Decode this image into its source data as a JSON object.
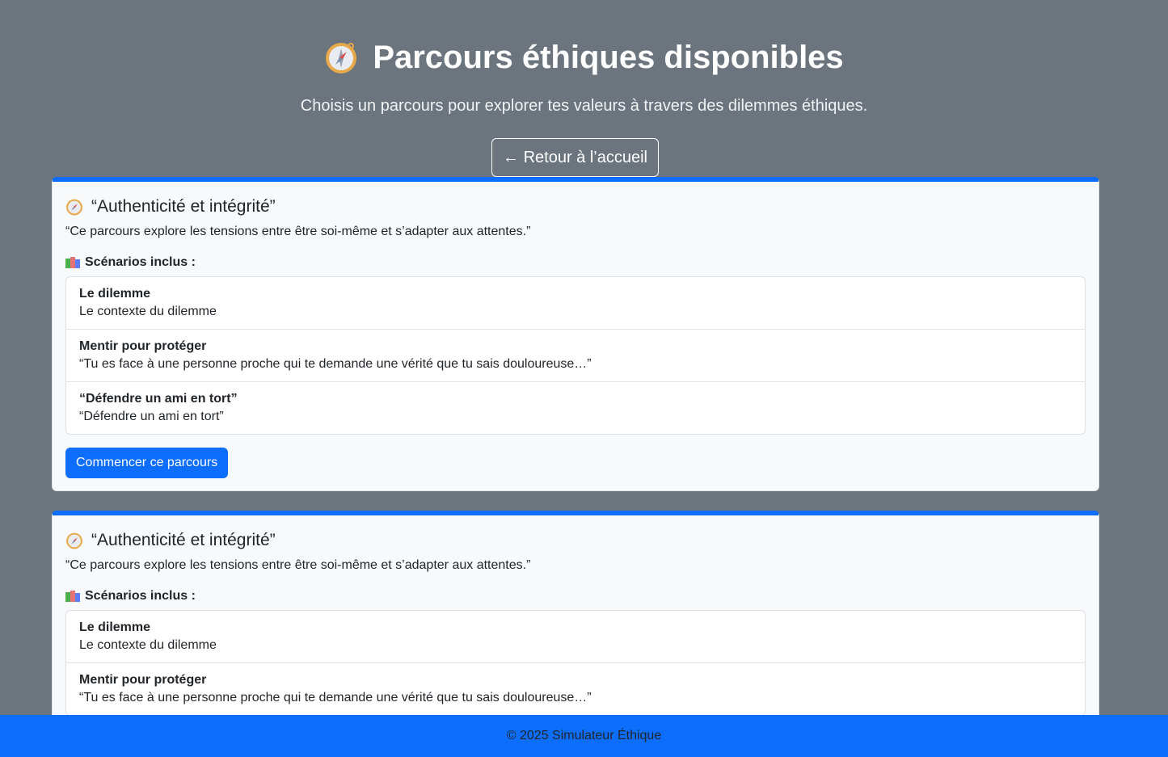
{
  "header": {
    "title": "Parcours éthiques disponibles",
    "subtitle": "Choisis un parcours pour explorer tes valeurs à travers des dilemmes éthiques.",
    "back_label": "← Retour à l’accueil",
    "icon": "compass-icon"
  },
  "parcours": [
    {
      "title": "“Authenticité et intégrité”",
      "description": "“Ce parcours explore les tensions entre être soi-même et s’adapter aux attentes.”",
      "scenarios_label": "Scénarios inclus :",
      "scenarios": [
        {
          "title": "Le dilemme",
          "text": "Le contexte du dilemme"
        },
        {
          "title": "Mentir pour protéger",
          "text": "“Tu es face à une personne proche qui te demande une vérité que tu sais douloureuse…”"
        },
        {
          "title": "“Défendre un ami en tort”",
          "text": "“Défendre un ami en tort”"
        }
      ],
      "start_label": "Commencer ce parcours"
    },
    {
      "title": "“Authenticité et intégrité”",
      "description": "“Ce parcours explore les tensions entre être soi-même et s’adapter aux attentes.”",
      "scenarios_label": "Scénarios inclus :",
      "scenarios": [
        {
          "title": "Le dilemme",
          "text": "Le contexte du dilemme"
        },
        {
          "title": "Mentir pour protéger",
          "text": "“Tu es face à une personne proche qui te demande une vérité que tu sais douloureuse…”"
        }
      ]
    }
  ],
  "footer": {
    "text": "© 2025 Simulateur Éthique"
  },
  "colors": {
    "background": "#6c757d",
    "primary": "#0d6efd",
    "card": "#f8f9fa"
  }
}
